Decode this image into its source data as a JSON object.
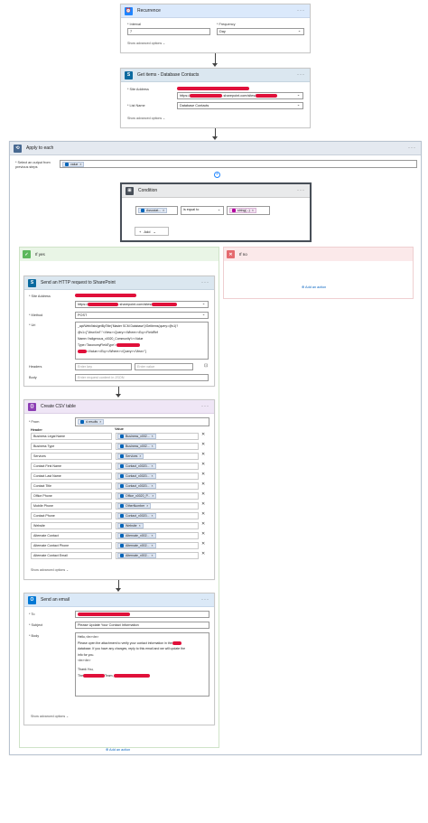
{
  "recurrence": {
    "title": "Recurrence",
    "interval_label": "* Interval",
    "interval_value": "7",
    "frequency_label": "* Frequency",
    "frequency_value": "Day",
    "advanced": "Show advanced options"
  },
  "get_items": {
    "title": "Get items - Database Contacts",
    "site_label": "* Site Address",
    "site_value": "https://██████.sharepoint.com/sites/██████",
    "site_prefix": "https://",
    "site_mid": ".sharepoint.com/sites/",
    "list_label": "* List Name",
    "list_value": "Database Contacts",
    "advanced": "Show advanced options"
  },
  "apply_each": {
    "title": "Apply to each",
    "select_label": "* Select an output from previous steps",
    "token": "value"
  },
  "condition": {
    "title": "Condition",
    "left_token": "Associat...",
    "operator": "is equal to",
    "right_token": "string(...)",
    "add_label": "Add"
  },
  "branches": {
    "yes": "If yes",
    "no": "If no",
    "add_action": "Add an action"
  },
  "http_request": {
    "title": "Send an HTTP request to SharePoint",
    "site_label": "* Site Address",
    "site_prefix": "https://",
    "site_mid": ".sharepoint.com/sites/",
    "method_label": "* Method",
    "method_value": "POST",
    "uri_label": "* Uri",
    "uri_lines": [
      "_api/Web/lists/getByTitle('Master SCM Database')/GetItems(query=@v1)?",
      "@v1={\"ViewXml\":\"<View><Query><Where><Eq><FieldRef",
      "Name='Indigenous_x0020_Community'/><Value",
      "Type='TaxonomyFieldType'>",
      "</Value></Eq></Where></Query></View>\"}"
    ],
    "headers_label": "Headers",
    "headers_key_ph": "Enter key",
    "headers_value_ph": "Enter value",
    "body_label": "Body",
    "body_ph": "Enter request content in JSON"
  },
  "csv": {
    "title": "Create CSV table",
    "from_label": "* From",
    "from_token": "d.results",
    "header_col": "Header",
    "value_col": "Value",
    "rows": [
      {
        "key": "Business Legal Name",
        "value": "Business_x002..."
      },
      {
        "key": "Business Type",
        "value": "Business_x002..."
      },
      {
        "key": "Services",
        "value": "Services"
      },
      {
        "key": "Contact First Name",
        "value": "Contact_x0020..."
      },
      {
        "key": "Contact Last Name",
        "value": "Contact_x0020..."
      },
      {
        "key": "Contact Title",
        "value": "Contact_x0020..."
      },
      {
        "key": "Office Phone",
        "value": "Office_x0020_P..."
      },
      {
        "key": "Mobile Phone",
        "value": "OtherNumber"
      },
      {
        "key": "Contact Phone",
        "value": "Contact_x0020..."
      },
      {
        "key": "Website",
        "value": "Website"
      },
      {
        "key": "Alternate Contact",
        "value": "Alternate_x002..."
      },
      {
        "key": "Alternate Contact Phone",
        "value": "Alternate_x002..."
      },
      {
        "key": "Alternate Contact Email",
        "value": "Alternate_x002..."
      }
    ],
    "advanced": "Show advanced options"
  },
  "email": {
    "title": "Send an email",
    "to_label": "* To",
    "subject_label": "* Subject",
    "subject_value": "Please Update Your Contact Information",
    "body_label": "* Body",
    "body_lines": [
      "Hello,<br><br>",
      "Please open the attachment to verify your contact information in the",
      "database. If you have any changes, reply to this email and we will update the",
      "info for you.",
      "<br><br>",
      "Thank You,",
      "The",
      "Team,"
    ],
    "advanced": "Show advanced options"
  },
  "colors": {
    "trigger": "#1f85ff",
    "sharepoint": "#0b6a9f",
    "loop": "#486991",
    "condition": "#484f58",
    "yes_bg": "#e9f5e6",
    "no_bg": "#fbe9ea",
    "data_ops": "#8c3db4",
    "outlook": "#0078d4",
    "redaction": "#e0103a"
  },
  "icons": {
    "recurrence": "alarm-clock-icon",
    "sharepoint": "sharepoint-icon",
    "loop": "loop-icon",
    "condition": "condition-icon",
    "check": "check-icon",
    "close": "close-icon",
    "data_ops": "data-operations-icon",
    "outlook": "outlook-icon"
  }
}
